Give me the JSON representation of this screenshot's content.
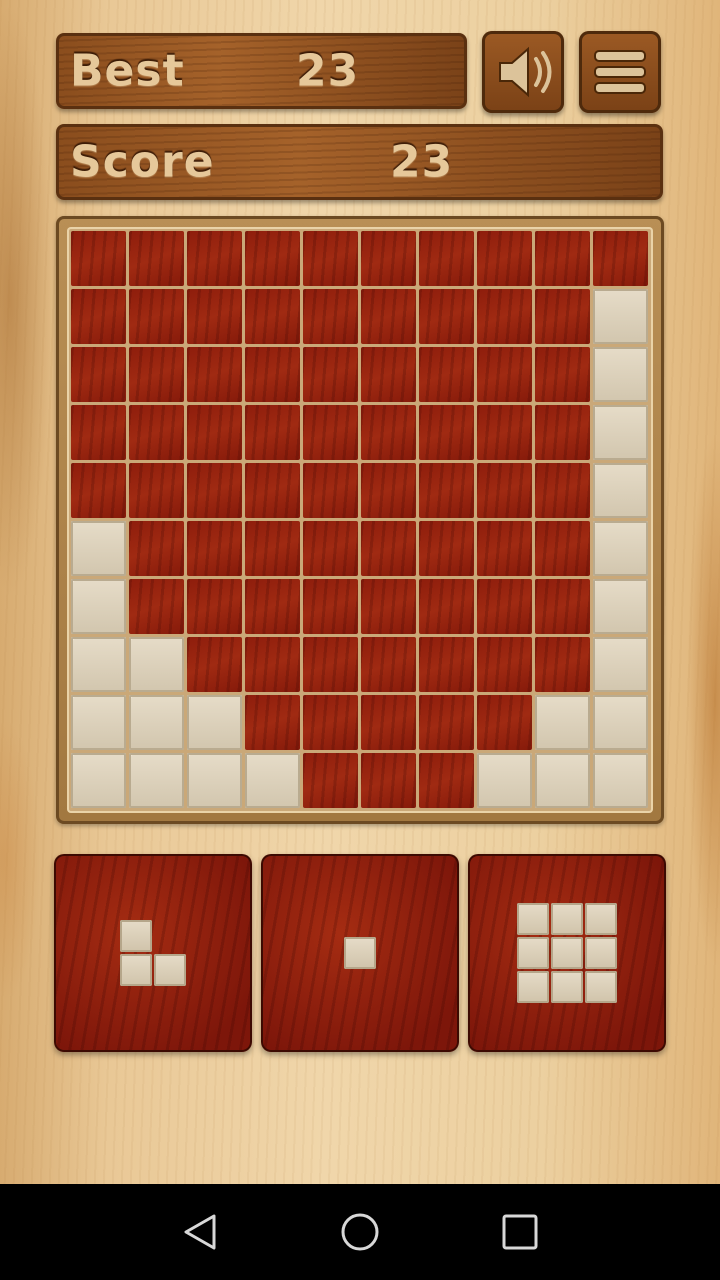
{
  "header": {
    "best_label": "Best",
    "best_value": "23",
    "score_label": "Score",
    "score_value": "23"
  },
  "buttons": {
    "sound_icon": "speaker-icon",
    "menu_icon": "menu-icon"
  },
  "board": {
    "rows": 10,
    "cols": 10,
    "cells": [
      "0000000000",
      "0000000001",
      "0000000001",
      "0000000001",
      "0000000001",
      "1000000001",
      "1000000001",
      "1100000001",
      "1110000011",
      "1111000111"
    ]
  },
  "pieces": [
    {
      "name": "corner-piece",
      "shape": [
        "10",
        "11"
      ]
    },
    {
      "name": "single-piece",
      "shape": [
        "1"
      ]
    },
    {
      "name": "square-3x3-piece",
      "shape": [
        "111",
        "111",
        "111"
      ]
    }
  ],
  "colors": {
    "empty_cell": "#a02a12",
    "filled_block": "#e6dcc8",
    "label_text": "#e6c89a"
  },
  "navigation": {
    "back": "back-triangle-icon",
    "home": "home-circle-icon",
    "recents": "recents-square-icon"
  }
}
